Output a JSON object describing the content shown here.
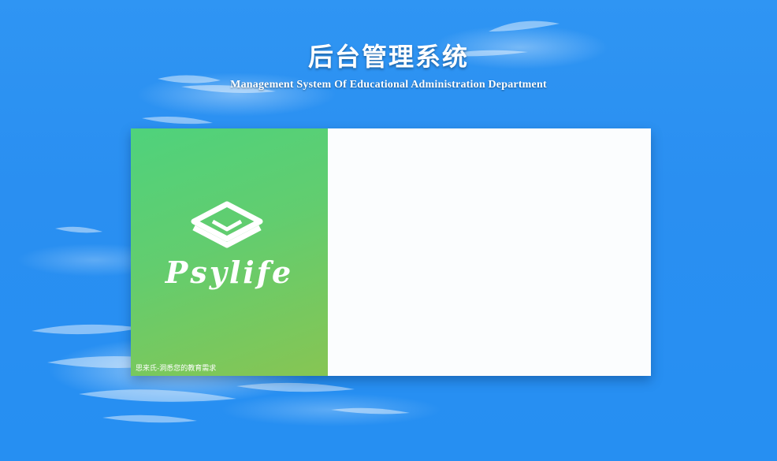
{
  "header": {
    "title": "后台管理系统",
    "subtitle": "Management System Of Educational Administration Department"
  },
  "brand": {
    "logo_icon": "psylife-cube-icon",
    "logo_text": "Psylife",
    "slogan": "思来氏-洞悉您的教育需求",
    "colors": {
      "gradient_start": "#4fd27c",
      "gradient_end": "#87c553"
    }
  },
  "background": {
    "color": "#2a8ff1",
    "icon": "sky-clouds"
  }
}
